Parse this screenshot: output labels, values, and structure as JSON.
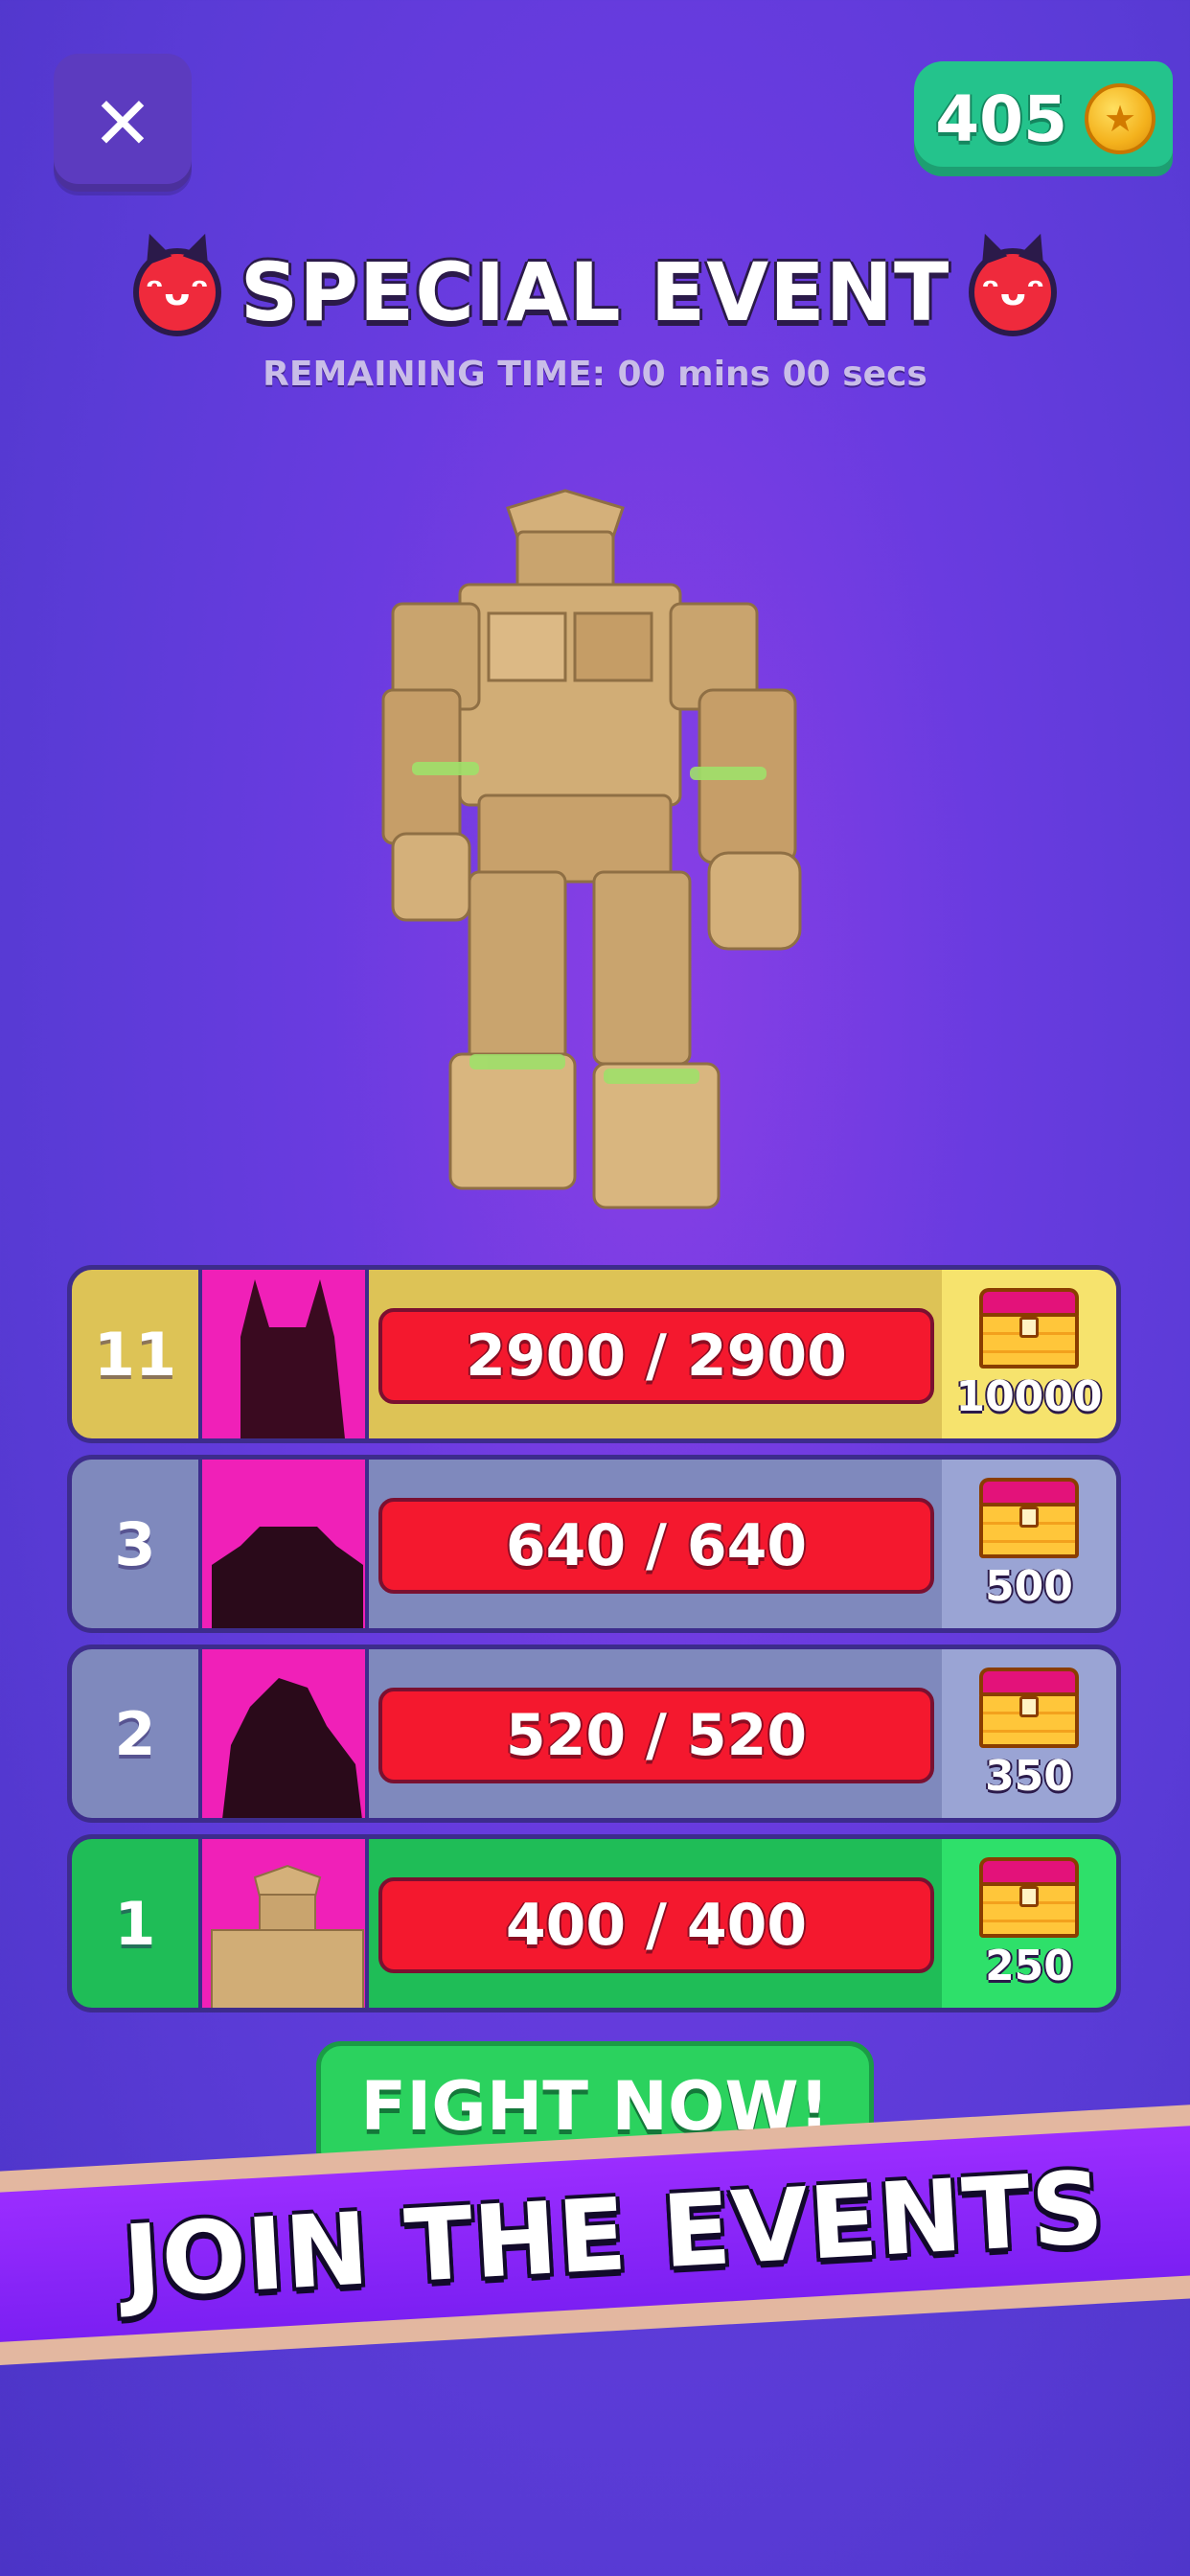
{
  "header": {
    "close_icon": "close-icon",
    "coins": "405",
    "coin_icon": "coin-icon"
  },
  "event": {
    "title": "SPECIAL EVENT",
    "remaining": "REMAINING TIME: 00 mins 00 secs",
    "badge_icon": "devil-icon"
  },
  "boss_list": [
    {
      "rank": "11",
      "hp": "2900 / 2900",
      "reward": "10000",
      "style": "gold"
    },
    {
      "rank": "3",
      "hp": "640 / 640",
      "reward": "500",
      "style": "slate"
    },
    {
      "rank": "2",
      "hp": "520 / 520",
      "reward": "350",
      "style": "slate"
    },
    {
      "rank": "1",
      "hp": "400 / 400",
      "reward": "250",
      "style": "green"
    }
  ],
  "fight_button": "FIGHT NOW!",
  "banner": "JOIN THE EVENTS",
  "colors": {
    "background": "#6a3be0",
    "hp_bar": "#f4182e",
    "row_gold": "#ddc356",
    "row_slate": "#7f89bd",
    "row_green": "#1fbd57",
    "banner": "#8a26f8"
  }
}
